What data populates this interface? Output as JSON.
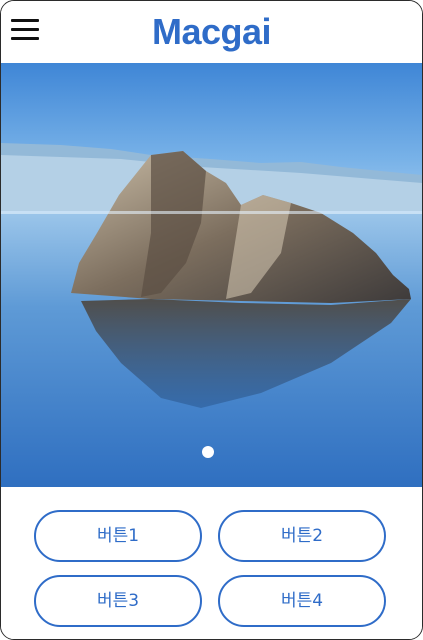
{
  "header": {
    "logo_text": "Macgai",
    "menu_icon": "hamburger-menu-icon"
  },
  "carousel": {
    "slide_count": 1,
    "active_index": 0
  },
  "buttons": [
    {
      "label": "버튼1"
    },
    {
      "label": "버튼2"
    },
    {
      "label": "버튼3"
    },
    {
      "label": "버튼4"
    }
  ],
  "colors": {
    "brand_blue": "#2f6cc8",
    "border": "#2b2b2b",
    "background": "#ffffff"
  }
}
